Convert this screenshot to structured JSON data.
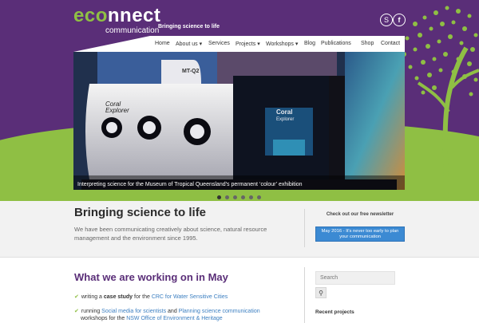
{
  "brand": {
    "logo_prefix": "ec",
    "logo_o": "o",
    "logo_suffix": "nnect",
    "logo_sub": "communication",
    "tagline": "Bringing science to life",
    "colors": {
      "purple": "#5a2e78",
      "green": "#8fbf44",
      "link": "#3c7fc1",
      "button": "#3c8ad3"
    }
  },
  "social": [
    {
      "icon": "skype-icon",
      "glyph": "S"
    },
    {
      "icon": "facebook-icon",
      "glyph": "f"
    }
  ],
  "nav": {
    "items": [
      {
        "label": "Home"
      },
      {
        "label": "About us",
        "caret": "▾"
      },
      {
        "label": "Services"
      },
      {
        "label": "Projects",
        "caret": "▾"
      },
      {
        "label": "Workshops",
        "caret": "▾"
      },
      {
        "label": "Blog"
      },
      {
        "label": "Publications"
      },
      {
        "label": "Shop"
      },
      {
        "label": "Contact"
      }
    ]
  },
  "slideshow": {
    "caption": "Interpreting science for the Museum of Tropical Queensland’s permanent ‘colour’ exhibition",
    "active_slide": 1,
    "total_slides": 6
  },
  "intro": {
    "heading": "Bringing science to life",
    "body": "We have been communicating creatively about science, natural resource management and the environment since 1995.",
    "newsletter_label": "Check out our free newsletter",
    "newsletter_button": "May 2016 - It's never too early to plan your communication"
  },
  "main": {
    "heading": "What we are working on in May",
    "items": [
      {
        "pre": "writing a ",
        "bold": "case study",
        "mid": " for the ",
        "link": "CRC for Water Sensitive Cities"
      },
      {
        "pre": "running ",
        "link1": "Social media for scientists",
        "mid": " and ",
        "link2": "Planning science communication"
      },
      {
        "pre": "workshops for the ",
        "link": "NSW Office of Environment & Heritage"
      }
    ]
  },
  "sidebar": {
    "search_placeholder": "Search",
    "recent_heading": "Recent projects"
  }
}
